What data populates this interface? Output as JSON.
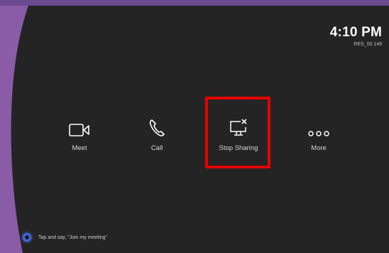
{
  "clock": {
    "time": "4:10 PM",
    "room": "RES_00.146"
  },
  "actions": [
    {
      "label": "Meet",
      "icon": "video-camera-icon"
    },
    {
      "label": "Call",
      "icon": "phone-icon"
    },
    {
      "label": "Stop Sharing",
      "icon": "stop-sharing-icon"
    },
    {
      "label": "More",
      "icon": "more-dots-icon"
    }
  ],
  "cortana": {
    "hint": "Tap and say, \"Join my meeting\""
  },
  "colors": {
    "background": "#252424",
    "accent_purple": "#6b4a91",
    "highlight": "#e60000",
    "cortana": "#3b6ce0"
  }
}
